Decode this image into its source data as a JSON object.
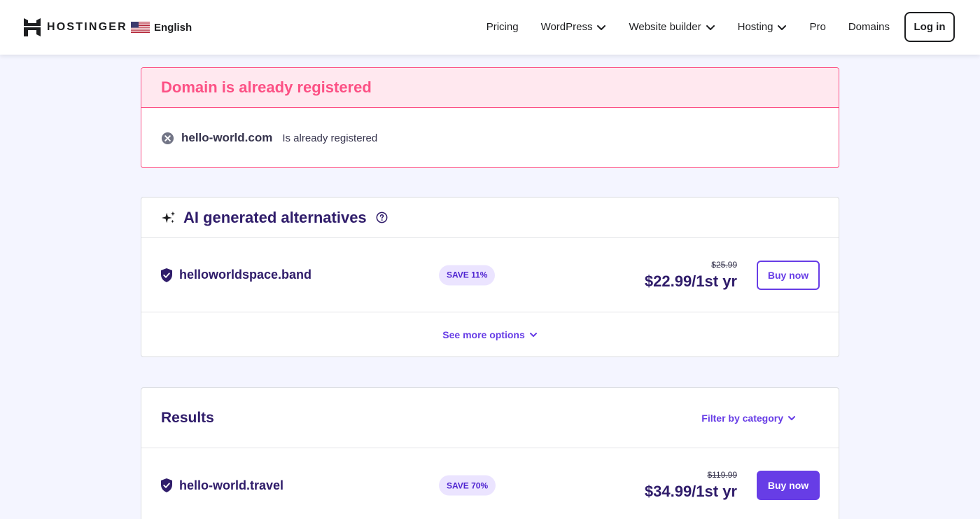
{
  "header": {
    "logo_text": "HOSTINGER",
    "language": "English",
    "nav": [
      {
        "label": "Pricing",
        "has_dropdown": false
      },
      {
        "label": "WordPress",
        "has_dropdown": true
      },
      {
        "label": "Website builder",
        "has_dropdown": true
      },
      {
        "label": "Hosting",
        "has_dropdown": true
      },
      {
        "label": "Pro",
        "has_dropdown": false
      },
      {
        "label": "Domains",
        "has_dropdown": false
      }
    ],
    "login_label": "Log in"
  },
  "error": {
    "title": "Domain is already registered",
    "domain": "hello-world.com",
    "message": "Is already registered",
    "icon": "x-circle-icon"
  },
  "ai_alternatives": {
    "title": "AI generated alternatives",
    "icon": "sparkle-icon",
    "items": [
      {
        "domain": "helloworldspace.band",
        "save_badge": "SAVE 11%",
        "old_price": "$25.99",
        "price": "$22.99/1st yr",
        "button_label": "Buy now",
        "button_style": "outline"
      }
    ],
    "see_more_label": "See more options"
  },
  "results": {
    "title": "Results",
    "filter_label": "Filter by category",
    "items": [
      {
        "domain": "hello-world.travel",
        "save_badge": "SAVE 70%",
        "old_price": "$119.99",
        "price": "$34.99/1st yr",
        "button_label": "Buy now",
        "button_style": "filled"
      }
    ]
  },
  "colors": {
    "brand_purple": "#673de6",
    "dark_purple": "#2f1c6a",
    "error_pink": "#fc5185",
    "error_bg": "#ffe8ef",
    "badge_bg": "#ebe4ff"
  }
}
